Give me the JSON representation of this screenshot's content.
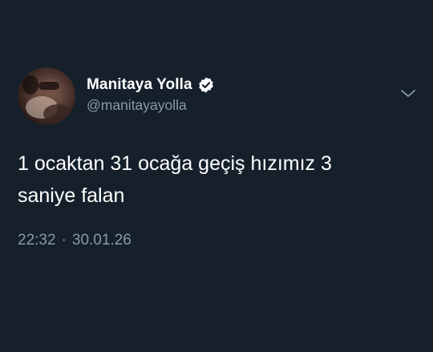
{
  "tweet": {
    "display_name": "Manitaya Yolla",
    "handle": "@manitayayolla",
    "verified": true,
    "text_line1": "1 ocaktan 31 ocağa geçiş hızımız 3",
    "text_line2": "saniye falan",
    "time": "22:32",
    "separator": "·",
    "date": "30.01.26"
  },
  "icons": {
    "verified": "verified-badge-icon",
    "menu": "chevron-down-icon"
  },
  "colors": {
    "background": "#15202b",
    "primary_text": "#ffffff",
    "secondary_text": "#8899a6"
  }
}
